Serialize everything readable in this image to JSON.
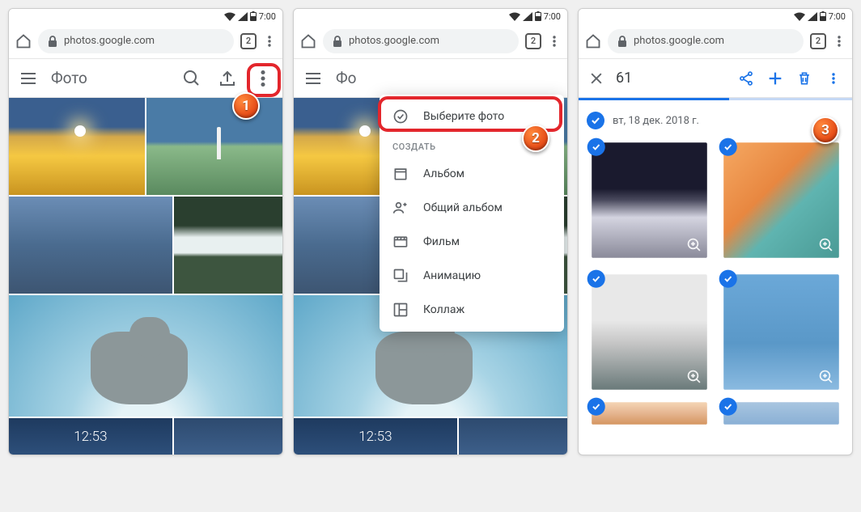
{
  "status": {
    "time": "7:00"
  },
  "browser": {
    "url": "photos.google.com",
    "tabs": "2"
  },
  "phone1": {
    "title": "Фото",
    "badge": "1"
  },
  "phone2": {
    "title": "Фо",
    "badge": "2",
    "menu": {
      "select": "Выберите фото",
      "create_section": "СОЗДАТЬ",
      "album": "Альбом",
      "shared": "Общий альбом",
      "movie": "Фильм",
      "animation": "Анимацию",
      "collage": "Коллаж"
    }
  },
  "phone3": {
    "count": "61",
    "date": "вт, 18 дек. 2018 г.",
    "badge": "3"
  }
}
